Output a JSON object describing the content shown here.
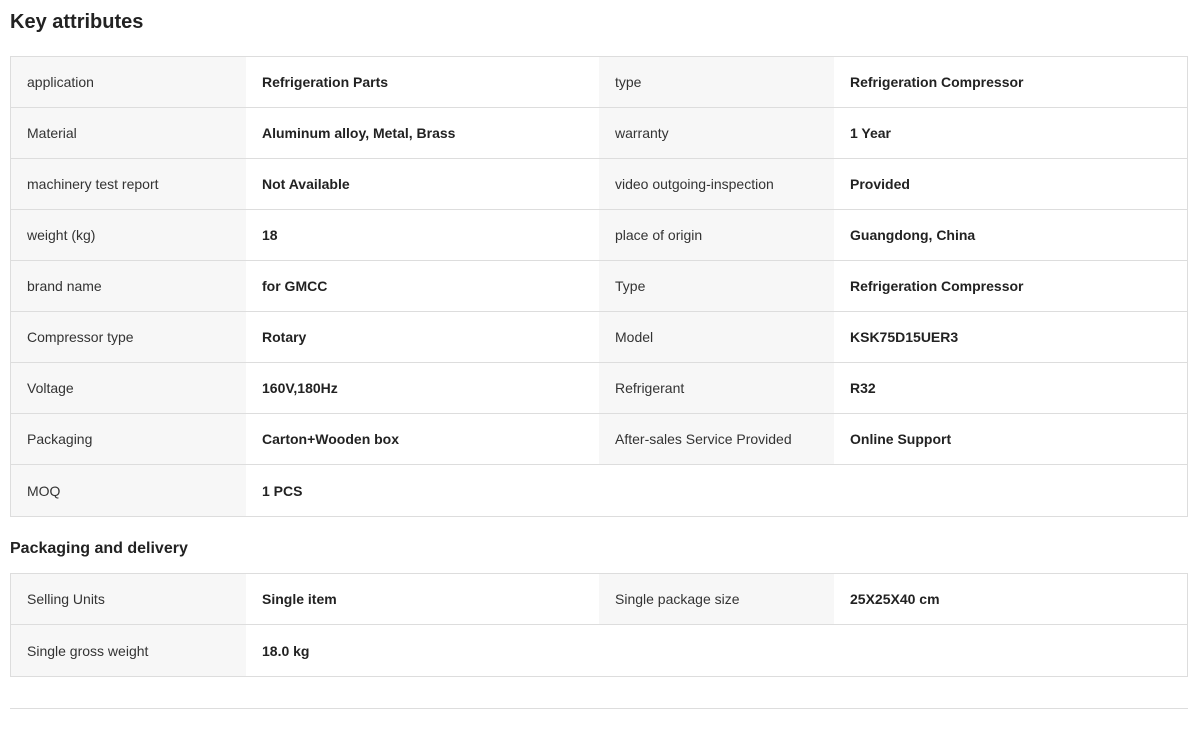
{
  "title": "Key attributes",
  "key_attributes": [
    {
      "k1": "application",
      "v1": "Refrigeration Parts",
      "k2": "type",
      "v2": "Refrigeration Compressor"
    },
    {
      "k1": "Material",
      "v1": "Aluminum alloy, Metal, Brass",
      "k2": "warranty",
      "v2": "1 Year"
    },
    {
      "k1": "machinery test report",
      "v1": "Not Available",
      "k2": "video outgoing-inspection",
      "v2": "Provided"
    },
    {
      "k1": "weight (kg)",
      "v1": "18",
      "k2": "place of origin",
      "v2": "Guangdong, China"
    },
    {
      "k1": "brand name",
      "v1": "for GMCC",
      "k2": "Type",
      "v2": "Refrigeration Compressor"
    },
    {
      "k1": "Compressor type",
      "v1": "Rotary",
      "k2": "Model",
      "v2": "KSK75D15UER3"
    },
    {
      "k1": "Voltage",
      "v1": "160V,180Hz",
      "k2": "Refrigerant",
      "v2": "R32"
    },
    {
      "k1": "Packaging",
      "v1": "Carton+Wooden box",
      "k2": "After-sales Service Provided",
      "v2": "Online Support"
    },
    {
      "k1": "MOQ",
      "v1": "1 PCS",
      "k2": "",
      "v2": ""
    }
  ],
  "packaging_title": "Packaging and delivery",
  "packaging": [
    {
      "k1": "Selling Units",
      "v1": "Single item",
      "k2": "Single package size",
      "v2": "25X25X40 cm"
    },
    {
      "k1": "Single gross weight",
      "v1": "18.0 kg",
      "k2": "",
      "v2": ""
    }
  ]
}
